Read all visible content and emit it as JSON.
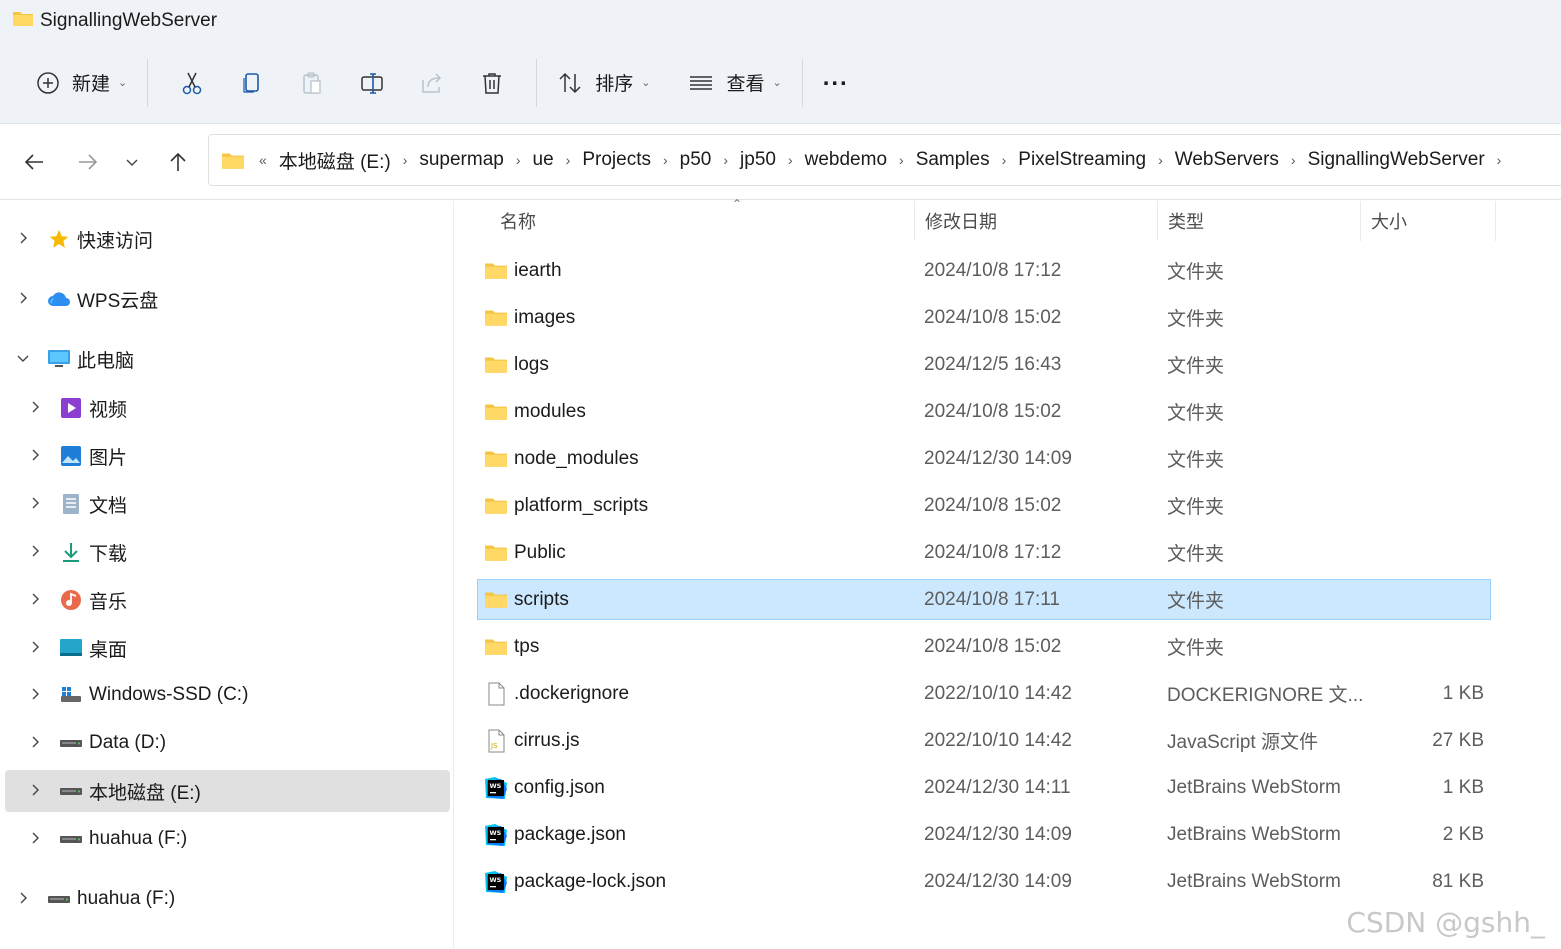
{
  "window": {
    "title": "SignallingWebServer"
  },
  "toolbar": {
    "new_label": "新建",
    "sort_label": "排序",
    "view_label": "查看",
    "more_label": "..."
  },
  "address": {
    "overflow": "«",
    "crumbs": [
      "本地磁盘 (E:)",
      "supermap",
      "ue",
      "Projects",
      "p50",
      "jp50",
      "webdemo",
      "Samples",
      "PixelStreaming",
      "WebServers",
      "SignallingWebServer"
    ]
  },
  "sidebar": {
    "items": [
      {
        "label": "快速访问",
        "icon": "star-icon"
      },
      {
        "label": "WPS云盘",
        "icon": "cloud-icon"
      },
      {
        "label": "此电脑",
        "icon": "monitor-icon"
      },
      {
        "label": "视频",
        "icon": "video-icon"
      },
      {
        "label": "图片",
        "icon": "picture-icon"
      },
      {
        "label": "文档",
        "icon": "document-icon"
      },
      {
        "label": "下载",
        "icon": "download-icon"
      },
      {
        "label": "音乐",
        "icon": "music-icon"
      },
      {
        "label": "桌面",
        "icon": "desktop-icon"
      },
      {
        "label": "Windows-SSD (C:)",
        "icon": "system-drive-icon"
      },
      {
        "label": "Data (D:)",
        "icon": "drive-icon"
      },
      {
        "label": "本地磁盘 (E:)",
        "icon": "drive-icon"
      },
      {
        "label": "huahua (F:)",
        "icon": "drive-icon"
      },
      {
        "label": "huahua (F:)",
        "icon": "drive-icon"
      }
    ]
  },
  "columns": {
    "name": "名称",
    "date": "修改日期",
    "type": "类型",
    "size": "大小"
  },
  "files": [
    {
      "name": "iearth",
      "date": "2024/10/8 17:12",
      "type": "文件夹",
      "size": "",
      "icon": "folder-icon"
    },
    {
      "name": "images",
      "date": "2024/10/8 15:02",
      "type": "文件夹",
      "size": "",
      "icon": "folder-icon"
    },
    {
      "name": "logs",
      "date": "2024/12/5 16:43",
      "type": "文件夹",
      "size": "",
      "icon": "folder-icon"
    },
    {
      "name": "modules",
      "date": "2024/10/8 15:02",
      "type": "文件夹",
      "size": "",
      "icon": "folder-icon"
    },
    {
      "name": "node_modules",
      "date": "2024/12/30 14:09",
      "type": "文件夹",
      "size": "",
      "icon": "folder-icon"
    },
    {
      "name": "platform_scripts",
      "date": "2024/10/8 15:02",
      "type": "文件夹",
      "size": "",
      "icon": "folder-icon"
    },
    {
      "name": "Public",
      "date": "2024/10/8 17:12",
      "type": "文件夹",
      "size": "",
      "icon": "folder-icon"
    },
    {
      "name": "scripts",
      "date": "2024/10/8 17:11",
      "type": "文件夹",
      "size": "",
      "icon": "folder-icon"
    },
    {
      "name": "tps",
      "date": "2024/10/8 15:02",
      "type": "文件夹",
      "size": "",
      "icon": "folder-icon"
    },
    {
      "name": ".dockerignore",
      "date": "2022/10/10 14:42",
      "type": "DOCKERIGNORE 文...",
      "size": "1 KB",
      "icon": "blank-file-icon"
    },
    {
      "name": "cirrus.js",
      "date": "2022/10/10 14:42",
      "type": "JavaScript 源文件",
      "size": "27 KB",
      "icon": "js-file-icon"
    },
    {
      "name": "config.json",
      "date": "2024/12/30 14:11",
      "type": "JetBrains WebStorm",
      "size": "1 KB",
      "icon": "webstorm-icon"
    },
    {
      "name": "package.json",
      "date": "2024/12/30 14:09",
      "type": "JetBrains WebStorm",
      "size": "2 KB",
      "icon": "webstorm-icon"
    },
    {
      "name": "package-lock.json",
      "date": "2024/12/30 14:09",
      "type": "JetBrains WebStorm",
      "size": "81 KB",
      "icon": "webstorm-icon"
    }
  ],
  "watermark": "CSDN @gshh_"
}
